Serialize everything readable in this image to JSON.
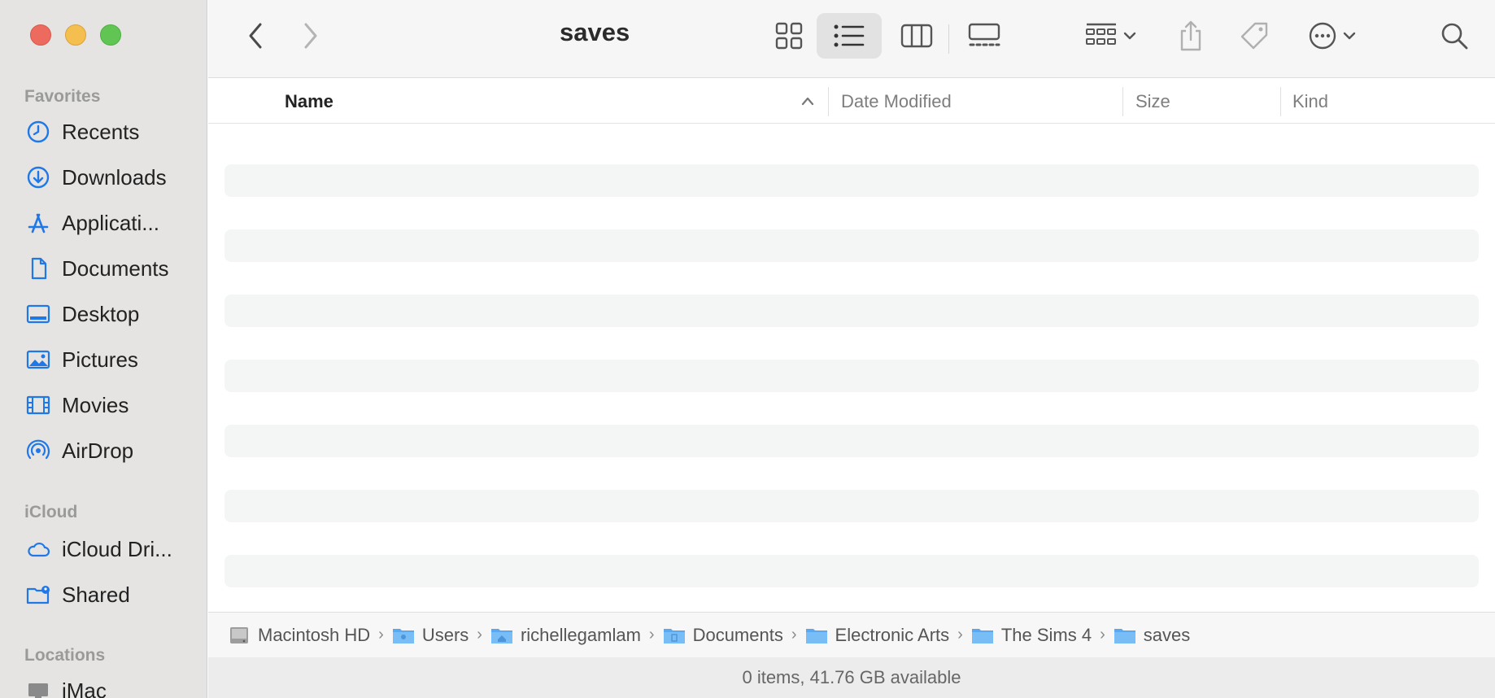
{
  "window": {
    "title": "saves"
  },
  "sidebar": {
    "favorites_title": "Favorites",
    "favorites": [
      {
        "label": "Recents",
        "icon": "clock-icon"
      },
      {
        "label": "Downloads",
        "icon": "download-icon"
      },
      {
        "label": "Applicati...",
        "icon": "applications-icon"
      },
      {
        "label": "Documents",
        "icon": "document-icon"
      },
      {
        "label": "Desktop",
        "icon": "desktop-icon"
      },
      {
        "label": "Pictures",
        "icon": "pictures-icon"
      },
      {
        "label": "Movies",
        "icon": "film-icon"
      },
      {
        "label": "AirDrop",
        "icon": "airdrop-icon"
      }
    ],
    "icloud_title": "iCloud",
    "icloud": [
      {
        "label": "iCloud Dri...",
        "icon": "cloud-icon"
      },
      {
        "label": "Shared",
        "icon": "shared-folder-icon"
      }
    ],
    "locations_title": "Locations",
    "locations": [
      {
        "label": "iMac",
        "icon": "imac-icon"
      }
    ]
  },
  "columns": {
    "name": "Name",
    "date": "Date Modified",
    "size": "Size",
    "kind": "Kind"
  },
  "pathbar": [
    {
      "label": "Macintosh HD",
      "icon": "hard-drive-icon"
    },
    {
      "label": "Users",
      "icon": "folder-icon"
    },
    {
      "label": "richellegamlam",
      "icon": "home-folder-icon"
    },
    {
      "label": "Documents",
      "icon": "folder-icon"
    },
    {
      "label": "Electronic Arts",
      "icon": "folder-icon"
    },
    {
      "label": "The Sims 4",
      "icon": "folder-icon"
    },
    {
      "label": "saves",
      "icon": "folder-icon"
    }
  ],
  "status": "0 items, 41.76 GB available",
  "colors": {
    "accent": "#1f78e8",
    "folder": "#5aa9f0",
    "sidebar_bg": "#e5e4e3"
  }
}
